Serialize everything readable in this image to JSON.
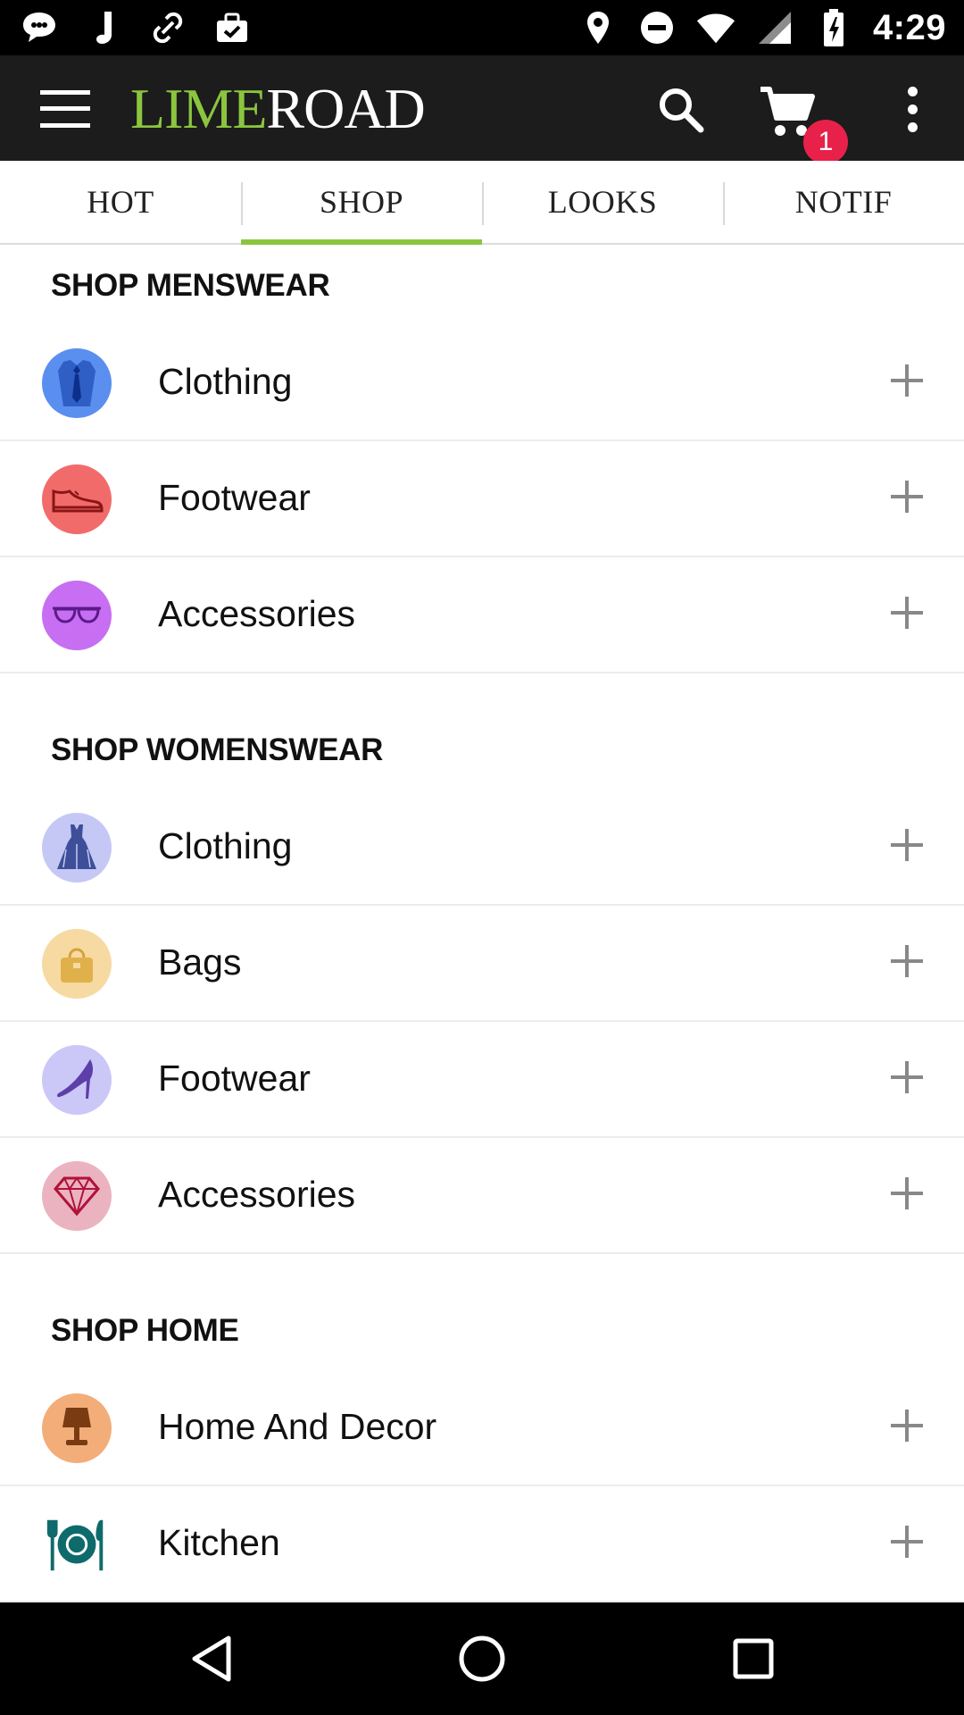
{
  "status_bar": {
    "time": "4:29",
    "left_icons": [
      "chat-icon",
      "music-note-icon",
      "link-icon",
      "briefcase-check-icon"
    ],
    "right_icons": [
      "location-icon",
      "do-not-disturb-icon",
      "wifi-icon",
      "signal-icon",
      "battery-icon"
    ]
  },
  "app_bar": {
    "logo_lime": "LIME",
    "logo_road": "ROAD",
    "cart_count": "1",
    "brand_color": "#8bc53f",
    "badge_color": "#e8214a"
  },
  "tabs": [
    {
      "label": "HOT",
      "active": false
    },
    {
      "label": "SHOP",
      "active": true
    },
    {
      "label": "LOOKS",
      "active": false
    },
    {
      "label": "NOTIF",
      "active": false
    }
  ],
  "sections": {
    "menswear": {
      "title": "SHOP MENSWEAR",
      "items": [
        {
          "label": "Clothing",
          "icon": "shirt-tie-icon",
          "color": "#5a8ff0"
        },
        {
          "label": "Footwear",
          "icon": "mens-shoe-icon",
          "color": "#f26b6b"
        },
        {
          "label": "Accessories",
          "icon": "sunglasses-icon",
          "color": "#c76ef2"
        }
      ]
    },
    "womenswear": {
      "title": "SHOP WOMENSWEAR",
      "items": [
        {
          "label": "Clothing",
          "icon": "dress-icon",
          "color": "#c5c8f5"
        },
        {
          "label": "Bags",
          "icon": "handbag-icon",
          "color": "#f7d9a2"
        },
        {
          "label": "Footwear",
          "icon": "high-heel-icon",
          "color": "#cbc7f7"
        },
        {
          "label": "Accessories",
          "icon": "diamond-icon",
          "color": "#ebb3c0"
        }
      ]
    },
    "home": {
      "title": "SHOP HOME",
      "items": [
        {
          "label": "Home And Decor",
          "icon": "lamp-icon",
          "color": "#f3ad78"
        },
        {
          "label": "Kitchen",
          "icon": "plate-cutlery-icon",
          "color": "#0f6b6b"
        }
      ]
    }
  },
  "nav_bar": {
    "buttons": [
      "back-icon",
      "home-icon",
      "recents-icon"
    ]
  }
}
